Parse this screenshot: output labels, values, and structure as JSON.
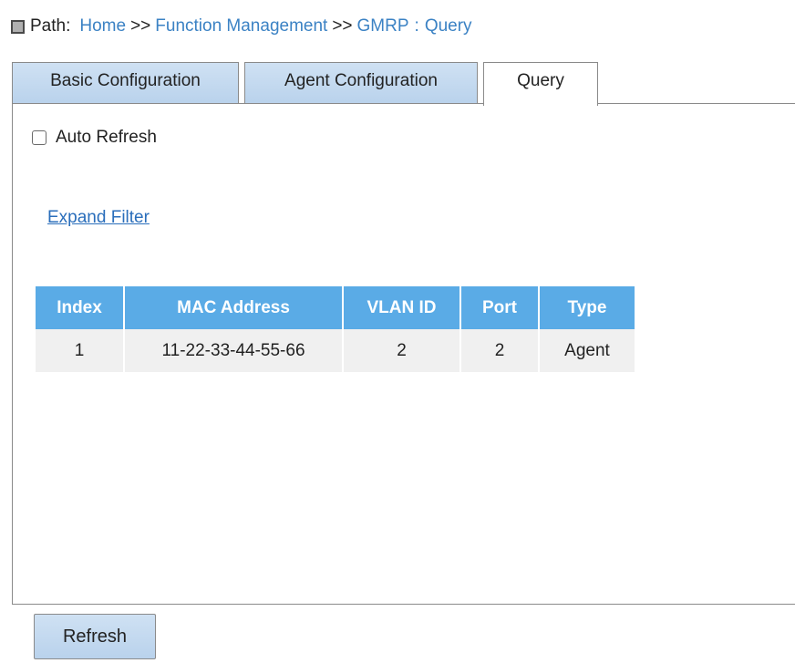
{
  "path": {
    "label": "Path:",
    "crumbs": [
      "Home",
      "Function Management",
      "GMRP",
      "Query"
    ],
    "separator": ">>",
    "colon": ":"
  },
  "tabs": [
    {
      "label": "Basic Configuration",
      "active": false
    },
    {
      "label": "Agent Configuration",
      "active": false
    },
    {
      "label": "Query",
      "active": true
    }
  ],
  "auto_refresh": {
    "label": "Auto Refresh",
    "checked": false
  },
  "expand_filter": "Expand Filter",
  "table": {
    "headers": [
      "Index",
      "MAC Address",
      "VLAN ID",
      "Port",
      "Type"
    ],
    "rows": [
      [
        "1",
        "11-22-33-44-55-66",
        "2",
        "2",
        "Agent"
      ]
    ]
  },
  "refresh_button": "Refresh",
  "colors": {
    "header_bg": "#5aabe6",
    "row_bg": "#f0f0f0",
    "link": "#3b82c4",
    "tab_bg": "#c4d9ef"
  }
}
